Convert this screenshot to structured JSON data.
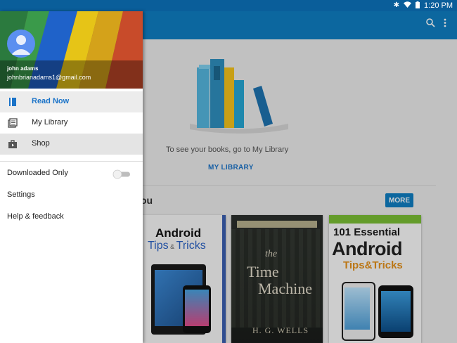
{
  "status_bar": {
    "bluetooth_icon": "bluetooth-icon",
    "wifi_icon": "wifi-icon",
    "battery_icon": "battery-icon",
    "time": "1:20 PM"
  },
  "toolbar": {
    "search_icon": "search-icon",
    "overflow_icon": "more-vert-icon"
  },
  "drawer": {
    "user_name": "john adams",
    "user_email": "johnbrianadams1@gmail.com",
    "nav": [
      {
        "label": "Read Now",
        "icon": "book-icon",
        "selected": true
      },
      {
        "label": "My Library",
        "icon": "library-icon",
        "selected": false
      },
      {
        "label": "Shop",
        "icon": "shop-bag-icon",
        "selected": false
      }
    ],
    "downloaded_only": {
      "label": "Downloaded Only",
      "value": false
    },
    "settings_label": "Settings",
    "help_label": "Help & feedback"
  },
  "main": {
    "empty_message": "To see your books, go to My Library",
    "my_library_link": "MY LIBRARY",
    "recommended_title_fragment": "ou",
    "more_button": "MORE",
    "books": [
      {
        "title_line1": "Android",
        "title_line2": "Tips",
        "title_line3": "Tricks"
      },
      {
        "title_line1": "the",
        "title_line2": "Time",
        "title_line3": "Machine",
        "author": "H. G. WELLS"
      },
      {
        "title_line1": "101 Essential",
        "title_line2": "Android",
        "title_line3": "Tips&Tricks"
      }
    ]
  }
}
